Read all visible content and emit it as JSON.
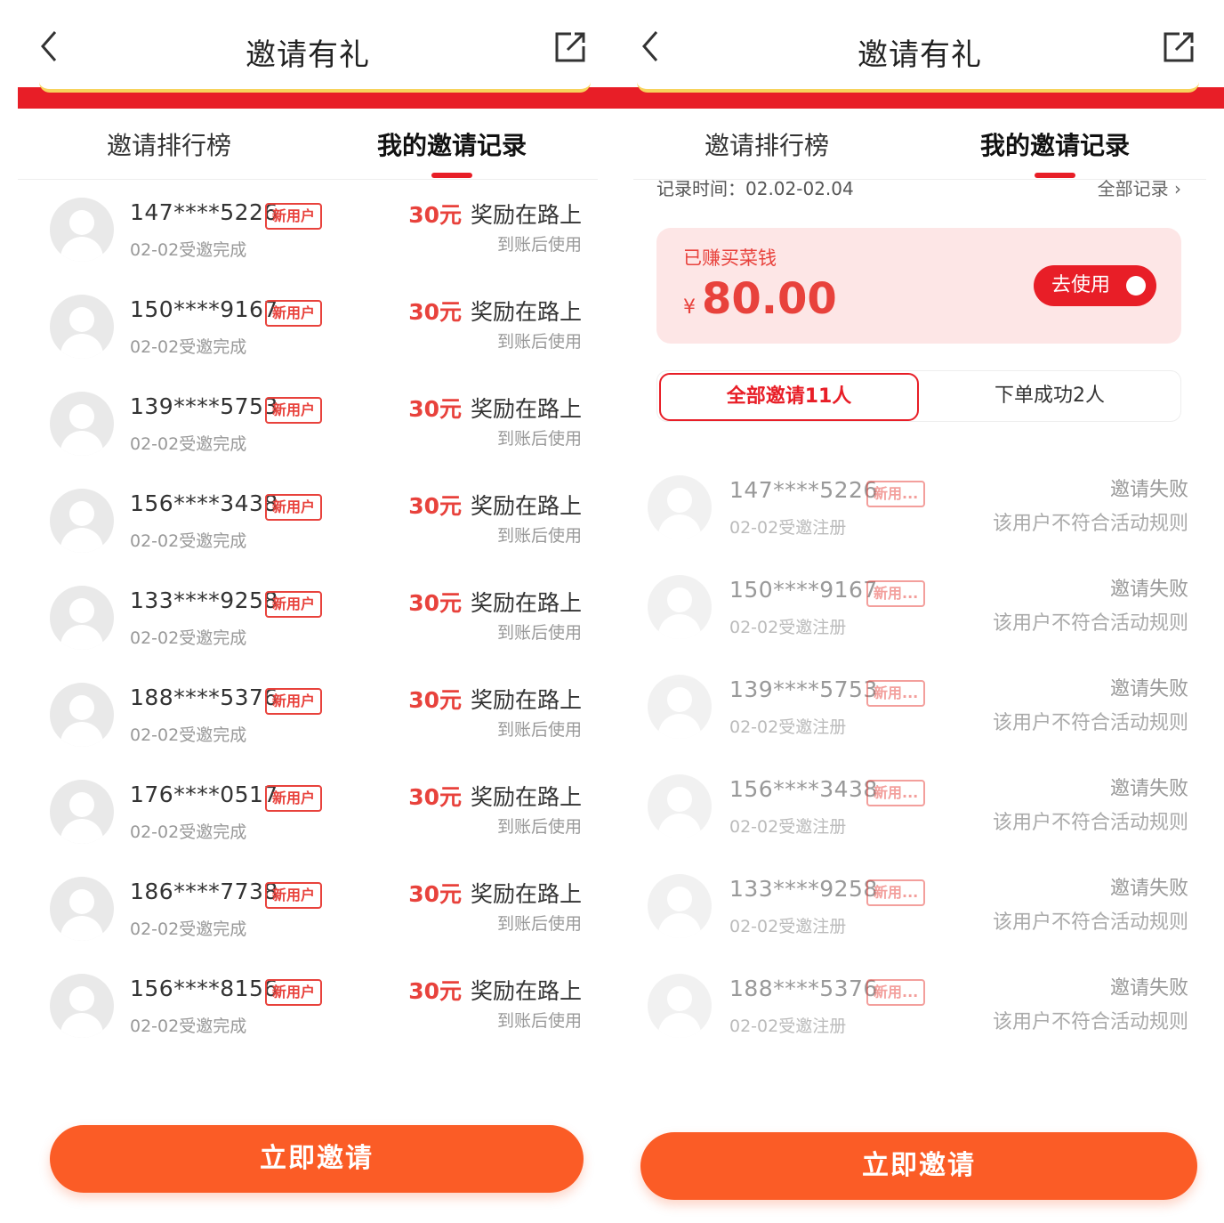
{
  "left": {
    "header": {
      "title": "邀请有礼"
    },
    "tabs": [
      {
        "label": "邀请排行榜"
      },
      {
        "label": "我的邀请记录"
      }
    ],
    "rows": [
      {
        "phone": "147****5226",
        "badge": "新用户",
        "sub": "02-02受邀完成",
        "amount": "30元",
        "status": "奖励在路上",
        "note": "到账后使用"
      },
      {
        "phone": "150****9167",
        "badge": "新用户",
        "sub": "02-02受邀完成",
        "amount": "30元",
        "status": "奖励在路上",
        "note": "到账后使用"
      },
      {
        "phone": "139****5753",
        "badge": "新用户",
        "sub": "02-02受邀完成",
        "amount": "30元",
        "status": "奖励在路上",
        "note": "到账后使用"
      },
      {
        "phone": "156****3438",
        "badge": "新用户",
        "sub": "02-02受邀完成",
        "amount": "30元",
        "status": "奖励在路上",
        "note": "到账后使用"
      },
      {
        "phone": "133****9258",
        "badge": "新用户",
        "sub": "02-02受邀完成",
        "amount": "30元",
        "status": "奖励在路上",
        "note": "到账后使用"
      },
      {
        "phone": "188****5376",
        "badge": "新用户",
        "sub": "02-02受邀完成",
        "amount": "30元",
        "status": "奖励在路上",
        "note": "到账后使用"
      },
      {
        "phone": "176****0517",
        "badge": "新用户",
        "sub": "02-02受邀完成",
        "amount": "30元",
        "status": "奖励在路上",
        "note": "到账后使用"
      },
      {
        "phone": "186****7738",
        "badge": "新用户",
        "sub": "02-02受邀完成",
        "amount": "30元",
        "status": "奖励在路上",
        "note": "到账后使用"
      },
      {
        "phone": "156****8156",
        "badge": "新用户",
        "sub": "02-02受邀完成",
        "amount": "30元",
        "status": "奖励在路上",
        "note": "到账后使用"
      }
    ],
    "cta": "立即邀请"
  },
  "right": {
    "header": {
      "title": "邀请有礼"
    },
    "tabs": [
      {
        "label": "邀请排行榜"
      },
      {
        "label": "我的邀请记录"
      }
    ],
    "record_time": "记录时间：02.02-02.04",
    "all_records": "全部记录 ›",
    "earned": {
      "label": "已赚买菜钱",
      "currency": "¥",
      "amount": "80.00",
      "use_button": "去使用"
    },
    "segments": {
      "all": "全部邀请11人",
      "success": "下单成功2人"
    },
    "rows": [
      {
        "phone": "147****5226",
        "badge": "新用...",
        "sub": "02-02受邀注册",
        "status": "邀请失败",
        "reason": "该用户不符合活动规则"
      },
      {
        "phone": "150****9167",
        "badge": "新用...",
        "sub": "02-02受邀注册",
        "status": "邀请失败",
        "reason": "该用户不符合活动规则"
      },
      {
        "phone": "139****5753",
        "badge": "新用...",
        "sub": "02-02受邀注册",
        "status": "邀请失败",
        "reason": "该用户不符合活动规则"
      },
      {
        "phone": "156****3438",
        "badge": "新用...",
        "sub": "02-02受邀注册",
        "status": "邀请失败",
        "reason": "该用户不符合活动规则"
      },
      {
        "phone": "133****9258",
        "badge": "新用...",
        "sub": "02-02受邀注册",
        "status": "邀请失败",
        "reason": "该用户不符合活动规则"
      },
      {
        "phone": "188****5376",
        "badge": "新用...",
        "sub": "02-02受邀注册",
        "status": "邀请失败",
        "reason": "该用户不符合活动规则"
      }
    ],
    "cta": "立即邀请"
  },
  "colors": {
    "brand_red": "#e81e27",
    "cta_orange": "#fb5c26",
    "badge_red": "#e8423c"
  },
  "icons": {
    "back": "chevron-left-icon",
    "share": "external-share-icon",
    "arrow": "arrow-circle-right-icon"
  }
}
